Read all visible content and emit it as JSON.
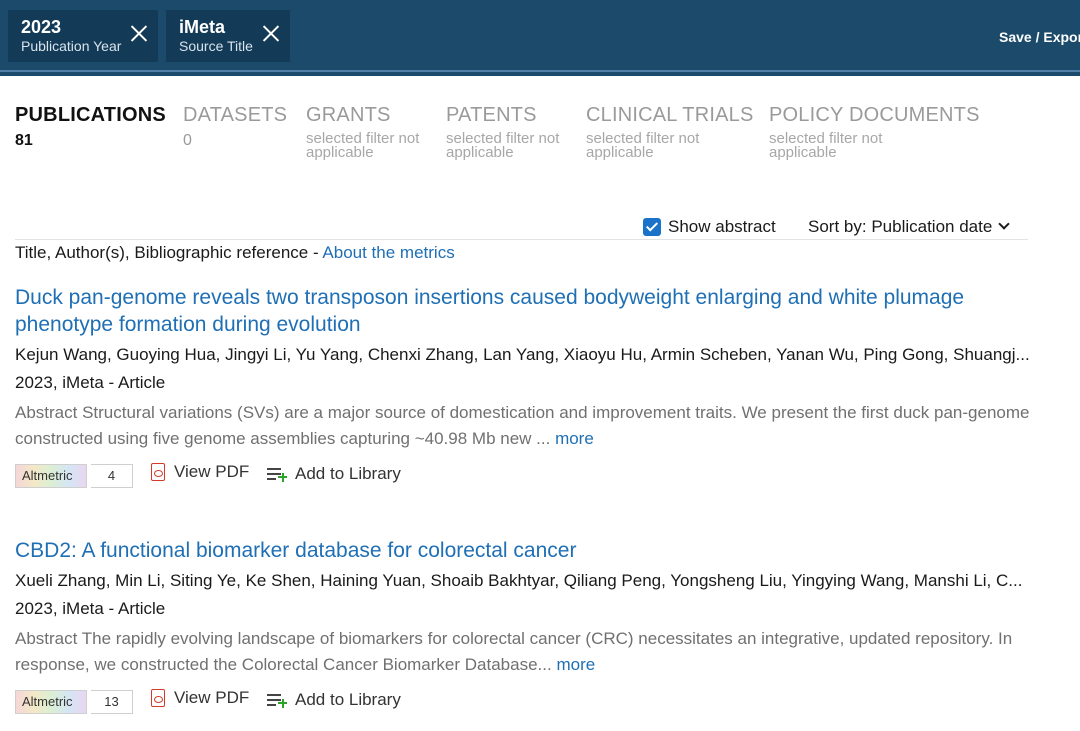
{
  "filters": [
    {
      "value": "2023",
      "label": "Publication Year"
    },
    {
      "value": "iMeta",
      "label": "Source Title"
    }
  ],
  "save_export_label": "Save / Expor",
  "tabs": [
    {
      "name": "PUBLICATIONS",
      "count": "81",
      "note": ""
    },
    {
      "name": "DATASETS",
      "count": "0",
      "note": ""
    },
    {
      "name": "GRANTS",
      "count": "",
      "note": "selected filter not applicable"
    },
    {
      "name": "PATENTS",
      "count": "",
      "note": "selected filter not applicable"
    },
    {
      "name": "CLINICAL TRIALS",
      "count": "",
      "note": "selected filter not applicable"
    },
    {
      "name": "POLICY DOCUMENTS",
      "count": "",
      "note": "selected filter not applicable"
    }
  ],
  "toolbar": {
    "show_abstract_label": "Show abstract",
    "show_abstract_checked": true,
    "sort_label": "Sort by:",
    "sort_value": "Publication date"
  },
  "list_header": {
    "text": "Title, Author(s), Bibliographic reference - ",
    "link": "About the metrics"
  },
  "results": [
    {
      "title": "Duck pan-genome reveals two transposon insertions caused bodyweight enlarging and white plumage phenotype formation during evolution",
      "authors": "Kejun Wang, Guoying Hua, Jingyi Li, Yu Yang, Chenxi Zhang, Lan Yang, Xiaoyu Hu, Armin Scheben, Yanan Wu, Ping Gong, Shuangj...",
      "meta": "2023, iMeta - Article",
      "abstract": "Abstract Structural variations (SVs) are a major source of domestication and improvement traits. We present the first duck pan-genome constructed using five genome assemblies capturing ~40.98 Mb new ...",
      "more_label": "more",
      "altmetric_label": "Altmetric",
      "altmetric_score": "4",
      "view_pdf_label": "View PDF",
      "add_library_label": "Add to Library"
    },
    {
      "title": "CBD2: A functional biomarker database for colorectal cancer",
      "authors": "Xueli Zhang, Min Li, Siting Ye, Ke Shen, Haining Yuan, Shoaib Bakhtyar, Qiliang Peng, Yongsheng Liu, Yingying Wang, Manshi Li, C...",
      "meta": "2023, iMeta - Article",
      "abstract": "Abstract The rapidly evolving landscape of biomarkers for colorectal cancer (CRC) necessitates an integrative, updated repository. In response, we constructed the Colorectal Cancer Biomarker Database...",
      "more_label": "more",
      "altmetric_label": "Altmetric",
      "altmetric_score": "13",
      "view_pdf_label": "View PDF",
      "add_library_label": "Add to Library"
    }
  ],
  "colors": {
    "topbar": "#1b4a6b",
    "chip": "#133a56",
    "link": "#1f6fb5",
    "checkbox": "#1a73c9"
  }
}
